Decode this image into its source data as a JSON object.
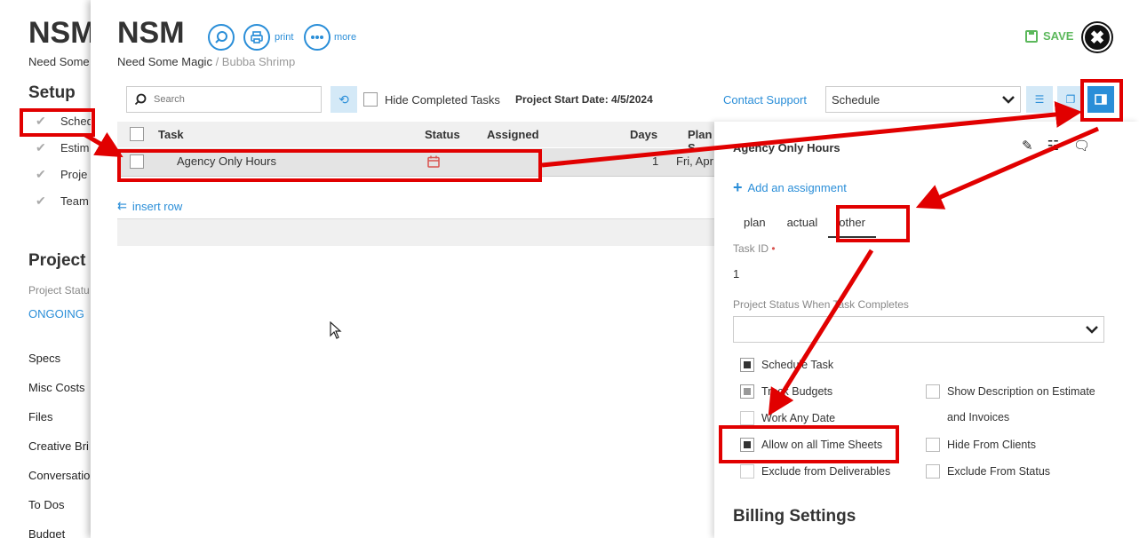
{
  "background": {
    "title": "NSM",
    "client": "Need Some",
    "setup_heading": "Setup",
    "setup_items": [
      "Sched",
      "Estim",
      "Proje",
      "Team"
    ],
    "section_heading": "Project I",
    "status_label": "Project Statu",
    "status_value": "ONGOING",
    "nav_items": [
      "Specs",
      "Misc Costs",
      "Files",
      "Creative Bri",
      "Conversatio",
      "To Dos",
      "Budget"
    ]
  },
  "modal": {
    "title": "NSM",
    "breadcrumb_client": "Need Some Magic",
    "breadcrumb_sep": " / ",
    "breadcrumb_project": "Bubba Shrimp",
    "print_label": "print",
    "more_label": "more",
    "save_label": "SAVE",
    "close_glyph": "✖"
  },
  "toolbar": {
    "search_placeholder": "Search",
    "hide_completed_label": "Hide Completed Tasks",
    "start_date_label": "Project Start Date: 4/5/2024",
    "contact_support": "Contact Support",
    "view_select_value": "Schedule"
  },
  "table": {
    "headers": [
      "Task",
      "Status",
      "Assigned",
      "Days",
      "Plan S"
    ],
    "rows": [
      {
        "task": "Agency Only Hours",
        "days": "1",
        "plan_start": "Fri, Apr"
      }
    ],
    "insert_row_label": "insert row"
  },
  "panel": {
    "task_title": "Agency Only Hours",
    "add_assignment": "Add an assignment",
    "tabs": [
      "plan",
      "actual",
      "other"
    ],
    "active_tab": "other",
    "task_id_label": "Task ID",
    "task_id_value": "1",
    "project_status_label": "Project Status When Task Completes",
    "options_left": [
      {
        "label": "Schedule Task",
        "checked": true
      },
      {
        "label": "Track Budgets",
        "checked": true
      },
      {
        "label": "Work Any Date",
        "checked": false
      },
      {
        "label": "Allow on all Time Sheets",
        "checked": true
      },
      {
        "label": "Exclude from Deliverables",
        "checked": false
      }
    ],
    "options_right": [
      {
        "label": "Show Description on Estimate",
        "checked": false
      },
      {
        "label": "and Invoices"
      },
      {
        "label": "Hide From Clients",
        "checked": false
      },
      {
        "label": "Exclude From Status",
        "checked": false
      }
    ],
    "billing_heading": "Billing Settings"
  },
  "colors": {
    "accent": "#2a8ed8",
    "save_green": "#5cb85c",
    "annotation_red": "#e10000"
  }
}
